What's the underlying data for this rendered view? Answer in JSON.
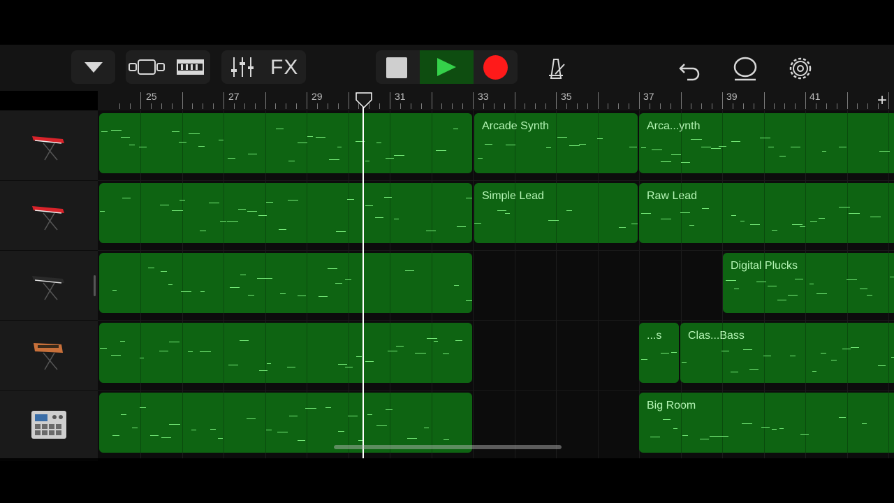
{
  "toolbar": {
    "dropdown_icon": "triangle-down-icon",
    "view_icon": "tracks-view-icon",
    "loop_icon": "loop-browser-icon",
    "mixer_icon": "mixer-sliders-icon",
    "fx_label": "FX",
    "stop_icon": "stop-icon",
    "play_icon": "play-icon",
    "record_icon": "record-icon",
    "metronome_icon": "metronome-icon",
    "undo_icon": "undo-icon",
    "loop_mode_icon": "lasso-icon",
    "settings_icon": "gear-icon",
    "colors": {
      "play_bg": "#0e4d10",
      "play": "#35d14a",
      "record": "#ff1a1a"
    }
  },
  "ruler": {
    "bars": [
      "25",
      "27",
      "29",
      "31",
      "33",
      "35",
      "37",
      "39",
      "41"
    ],
    "add_label": "+"
  },
  "tracks": [
    {
      "instrument": "red-synth-keyboard-icon",
      "regions": [
        "",
        "Arcade Synth",
        "Arca...ynth"
      ]
    },
    {
      "instrument": "red-synth-keyboard-icon",
      "regions": [
        "",
        "Simple Lead",
        "Raw Lead"
      ]
    },
    {
      "instrument": "black-keyboard-icon",
      "regions": [
        "",
        "Digital Plucks"
      ]
    },
    {
      "instrument": "analog-synth-icon",
      "regions": [
        "",
        "...s",
        "Clas...Bass"
      ]
    },
    {
      "instrument": "drum-machine-icon",
      "regions": [
        "",
        "Big Room"
      ]
    }
  ],
  "colors": {
    "region": "#0e6412",
    "note": "#76ea79",
    "region_text": "#b5f5b5",
    "background": "#0c0c0c"
  }
}
